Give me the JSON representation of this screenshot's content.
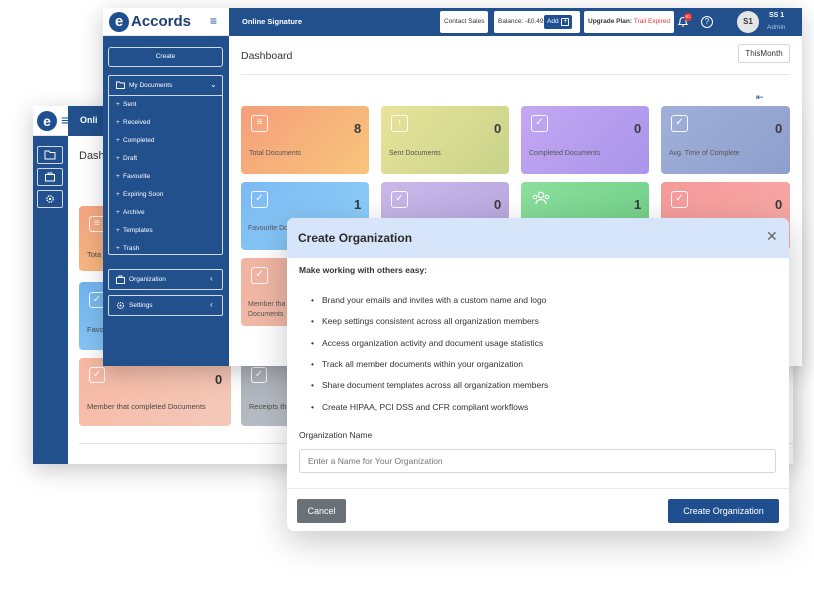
{
  "back_window": {
    "logo_letter": "e",
    "menu_glyph": "≡",
    "bar_text": "Onli",
    "sidebar_icons": [
      "folder-icon",
      "briefcase-icon",
      "gear-icon"
    ],
    "page_title": "Dashb",
    "cards": [
      {
        "label": "Tota",
        "count": ""
      },
      {
        "label": "Favo",
        "count": ""
      },
      {
        "label": "Member that completed Documents",
        "count": "0"
      },
      {
        "label": "Receipts th",
        "count": ""
      }
    ]
  },
  "app": {
    "logo_letter": "e",
    "logo_text": "Accords",
    "menu_glyph": "≡",
    "title": "Online Signature",
    "contact_sales": "Contact Sales",
    "balance": "Balance: -£0.49",
    "add_label": "Add",
    "upgrade_label": "Upgrade Plan:",
    "trial_status": "Trail Expired",
    "notification_count": "61",
    "avatar_initials": "S1",
    "user_name": "SS 1",
    "user_role": "Admin"
  },
  "sidebar": {
    "create_label": "Create",
    "my_documents": "My Documents",
    "sub_items": [
      "Sent",
      "Received",
      "Completed",
      "Draft",
      "Favourite",
      "Expiring Soon",
      "Archive",
      "Templates",
      "Trash"
    ],
    "organization": "Organization",
    "settings": "Settings"
  },
  "dashboard": {
    "title": "Dashboard",
    "period": "ThisMonth",
    "cards_row1": [
      {
        "label": "Total Documents",
        "count": "8",
        "color_a": "#f59e7b",
        "color_b": "#f8c57b"
      },
      {
        "label": "Sent Documents",
        "count": "0",
        "color_a": "#e9e39a",
        "color_b": "#c6d389"
      },
      {
        "label": "Completed Documents",
        "count": "0",
        "color_a": "#c3a7f2",
        "color_b": "#a995ea"
      },
      {
        "label": "Avg. Time of Complete",
        "count": "0",
        "color_a": "#9fb0d9",
        "color_b": "#8e9fcc"
      }
    ],
    "cards_row2": [
      {
        "label": "Favourite Do",
        "count": "1",
        "color_a": "#7bbaf2",
        "color_b": "#8fd0fa"
      },
      {
        "label": "",
        "count": "0",
        "color_a": "#c9b8e8",
        "color_b": "#b7a6df"
      },
      {
        "label": "",
        "count": "1",
        "color_a": "#8cde9d",
        "color_b": "#6fcf87"
      },
      {
        "label": "",
        "count": "0",
        "color_a": "#f59a9a",
        "color_b": "#f7aaa8"
      }
    ],
    "cards_row3": [
      {
        "label_line1": "Member tha",
        "label_line2": "Documents"
      }
    ]
  },
  "modal": {
    "title": "Create Organization",
    "subtitle": "Make working with others easy:",
    "bullets": [
      "Brand your emails and invites with a custom name and logo",
      "Keep settings consistent across all organization members",
      "Access organization activity and document usage statistics",
      "Track all member documents within your organization",
      "Share document templates across all organization members",
      "Create HIPAA, PCI DSS and CFR compliant workflows"
    ],
    "field_label": "Organization Name",
    "field_placeholder": "Enter a Name for Your Organization",
    "cancel_label": "Cancel",
    "create_label": "Create Organization",
    "header_color": "#d6e5fa",
    "primary_color": "#1f4f8f"
  }
}
